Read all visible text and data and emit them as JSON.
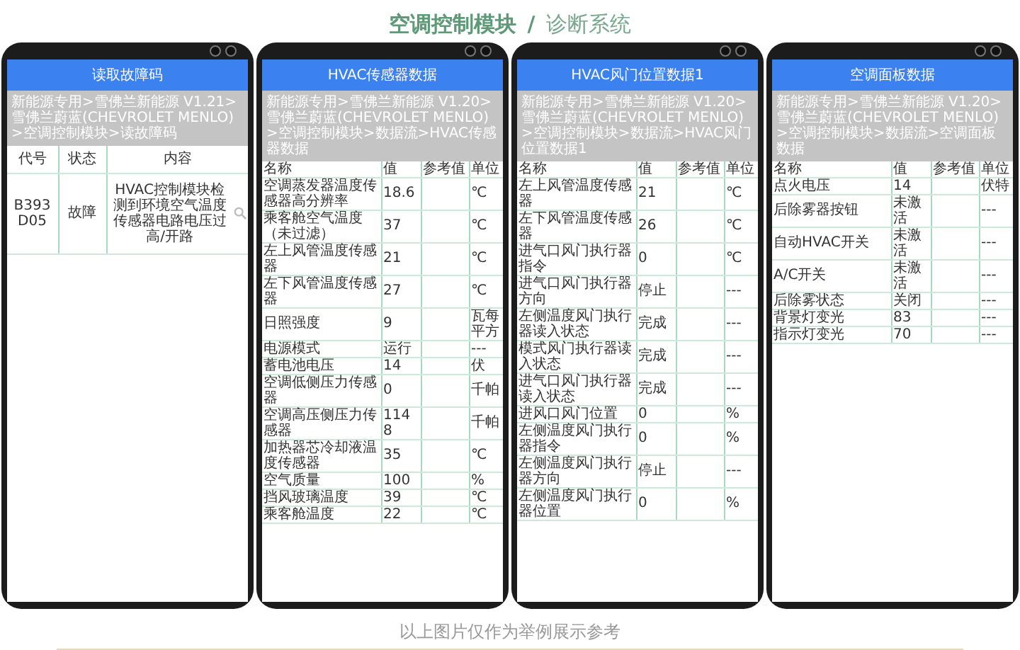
{
  "title": {
    "module": "空调控制模块",
    "separator": "/",
    "system": "诊断系统"
  },
  "phones": [
    {
      "kind": "fault",
      "header": "读取故障码",
      "breadcrumb": "新能源专用>雪佛兰新能源 V1.21>雪佛兰蔚蓝(CHEVROLET MENLO)>空调控制模块>读故障码",
      "columns": [
        "代号",
        "状态",
        "内容"
      ],
      "rows": [
        {
          "code": "B393D05",
          "status": "故障",
          "content": "HVAC控制模块检测到环境空气温度传感器电路电压过高/开路"
        }
      ]
    },
    {
      "kind": "data",
      "header": "HVAC传感器数据",
      "breadcrumb": "新能源专用>雪佛兰新能源 V1.20>雪佛兰蔚蓝(CHEVROLET MENLO)>空调控制模块>数据流>HVAC传感器数据",
      "columns": [
        "名称",
        "值",
        "参考值",
        "单位"
      ],
      "rows": [
        {
          "name": "空调蒸发器温度传感器高分辨率",
          "value": "18.6",
          "unit": "℃"
        },
        {
          "name": "乘客舱空气温度（未过滤）",
          "value": "37",
          "unit": "℃"
        },
        {
          "name": "左上风管温度传感器",
          "value": "21",
          "unit": "℃"
        },
        {
          "name": "左下风管温度传感器",
          "value": "27",
          "unit": "℃"
        },
        {
          "name": "日照强度",
          "value": "9",
          "unit": "瓦每平方"
        },
        {
          "name": "电源模式",
          "value": "运行",
          "unit": "---"
        },
        {
          "name": "蓄电池电压",
          "value": "14",
          "unit": "伏"
        },
        {
          "name": "空调低侧压力传感器",
          "value": "0",
          "unit": "千帕"
        },
        {
          "name": "空调高压侧压力传感器",
          "value": "1148",
          "unit": "千帕"
        },
        {
          "name": "加热器芯冷却液温度传感器",
          "value": "35",
          "unit": "℃"
        },
        {
          "name": "空气质量",
          "value": "100",
          "unit": "%"
        },
        {
          "name": "挡风玻璃温度",
          "value": "39",
          "unit": "℃"
        },
        {
          "name": "乘客舱温度",
          "value": "22",
          "unit": "℃"
        }
      ]
    },
    {
      "kind": "data",
      "header": "HVAC风门位置数据1",
      "breadcrumb": "新能源专用>雪佛兰新能源 V1.20>雪佛兰蔚蓝(CHEVROLET MENLO)>空调控制模块>数据流>HVAC风门位置数据1",
      "columns": [
        "名称",
        "值",
        "参考值",
        "单位"
      ],
      "rows": [
        {
          "name": "左上风管温度传感器",
          "value": "21",
          "unit": "℃"
        },
        {
          "name": "左下风管温度传感器",
          "value": "26",
          "unit": "℃"
        },
        {
          "name": "进气口风门执行器指令",
          "value": "0",
          "unit": "℃"
        },
        {
          "name": "进气口风门执行器方向",
          "value": "停止",
          "unit": "---"
        },
        {
          "name": "左侧温度风门执行器读入状态",
          "value": "完成",
          "unit": "---"
        },
        {
          "name": "模式风门执行器读入状态",
          "value": "完成",
          "unit": "---"
        },
        {
          "name": "进气口风门执行器读入状态",
          "value": "完成",
          "unit": "---"
        },
        {
          "name": "进风口风门位置",
          "value": "0",
          "unit": "%"
        },
        {
          "name": "左侧温度风门执行器指令",
          "value": "0",
          "unit": "%"
        },
        {
          "name": "左侧温度风门执行器方向",
          "value": "停止",
          "unit": "---"
        },
        {
          "name": "左侧温度风门执行器位置",
          "value": "0",
          "unit": "%"
        }
      ]
    },
    {
      "kind": "data",
      "header": "空调面板数据",
      "breadcrumb": "新能源专用>雪佛兰新能源 V1.20>雪佛兰蔚蓝(CHEVROLET MENLO)>空调控制模块>数据流>空调面板数据",
      "columns": [
        "名称",
        "值",
        "参考值",
        "单位"
      ],
      "rows": [
        {
          "name": "点火电压",
          "value": "14",
          "unit": "伏特"
        },
        {
          "name": "后除雾器按钮",
          "value": "未激活",
          "unit": "---"
        },
        {
          "name": "自动HVAC开关",
          "value": "未激活",
          "unit": "---"
        },
        {
          "name": "A/C开关",
          "value": "未激活",
          "unit": "---"
        },
        {
          "name": "后除雾状态",
          "value": "关闭",
          "unit": "---"
        },
        {
          "name": "背景灯变光",
          "value": "83",
          "unit": "---"
        },
        {
          "name": "指示灯变光",
          "value": "70",
          "unit": "---"
        }
      ]
    }
  ],
  "caption": "以上图片仅作为举例展示参考"
}
